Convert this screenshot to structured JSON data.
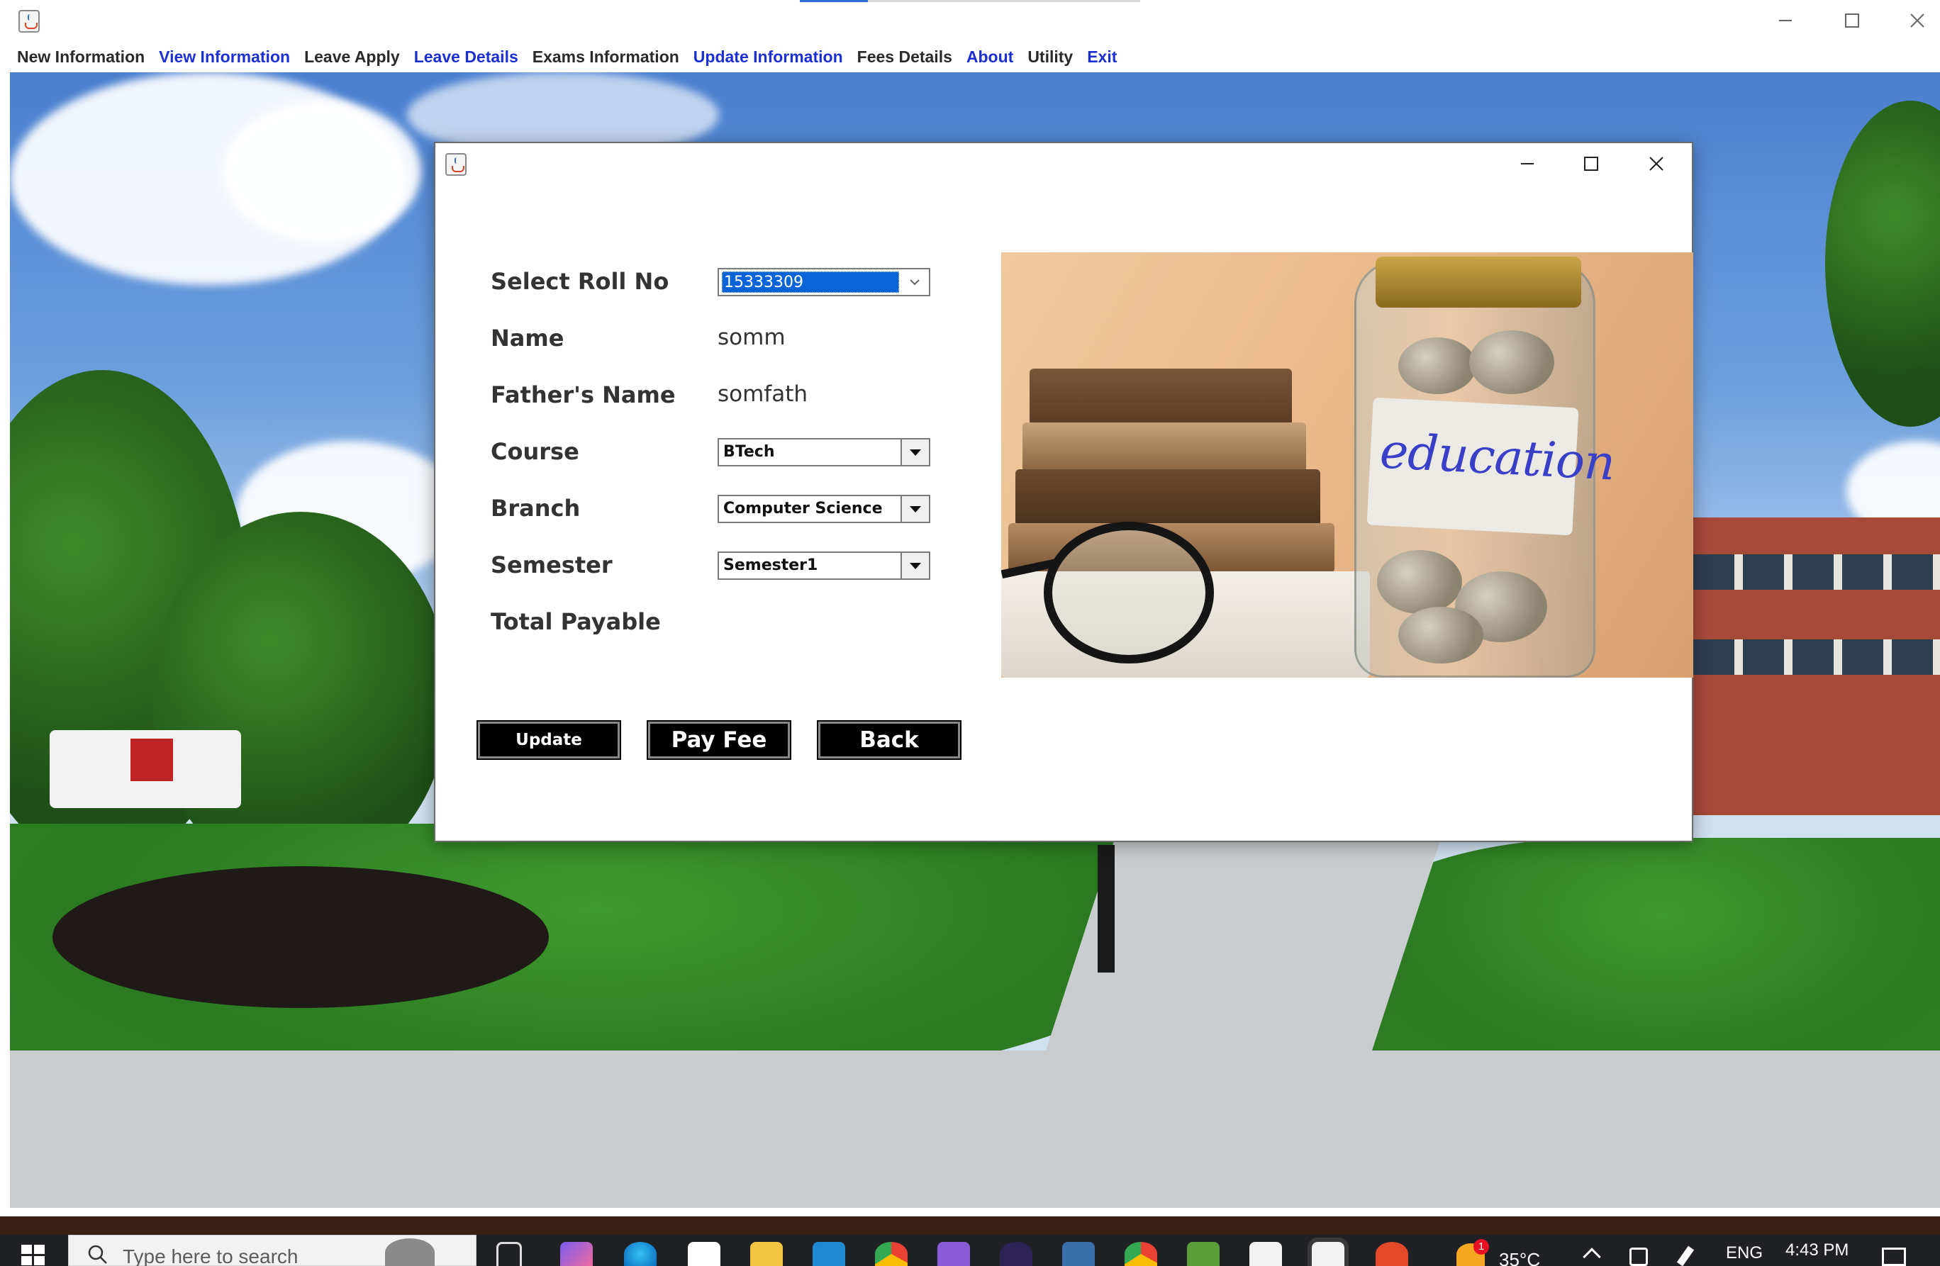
{
  "app": {
    "menu": [
      {
        "label": "New Information",
        "color": "#2a2a2a"
      },
      {
        "label": "View Information",
        "color": "#1c2fd1"
      },
      {
        "label": "Leave Apply",
        "color": "#2a2a2a"
      },
      {
        "label": "Leave Details",
        "color": "#1c2fd1"
      },
      {
        "label": "Exams Information",
        "color": "#2a2a2a"
      },
      {
        "label": "Update Information",
        "color": "#1c2fd1"
      },
      {
        "label": "Fees Details",
        "color": "#2a2a2a"
      },
      {
        "label": "About",
        "color": "#1c2fd1"
      },
      {
        "label": "Utility",
        "color": "#2a2a2a"
      },
      {
        "label": "Exit",
        "color": "#1c2fd1"
      }
    ],
    "window_icon": "java-coffee-icon"
  },
  "dialog": {
    "labels": {
      "roll_no": "Select Roll No",
      "name": "Name",
      "father_name": "Father's Name",
      "course": "Course",
      "branch": "Branch",
      "semester": "Semester",
      "total_payable": "Total Payable"
    },
    "values": {
      "roll_no": "15333309",
      "name": "somm",
      "father_name": "somfath",
      "course": "BTech",
      "branch": "Computer Science",
      "semester": "Semester1",
      "total_payable": ""
    },
    "buttons": {
      "update": "Update",
      "pay_fee": "Pay Fee",
      "back": "Back"
    },
    "photo": {
      "label_text": "education"
    }
  },
  "taskbar": {
    "search_placeholder": "Type here to search",
    "weather": "35°C",
    "language": "ENG",
    "time": "4:43 PM",
    "notification_badge": "1"
  },
  "colors": {
    "menu_blue": "#1c2fd1",
    "selection_blue": "#0a64d8",
    "button_black": "#000000",
    "taskbar": "#202124"
  }
}
